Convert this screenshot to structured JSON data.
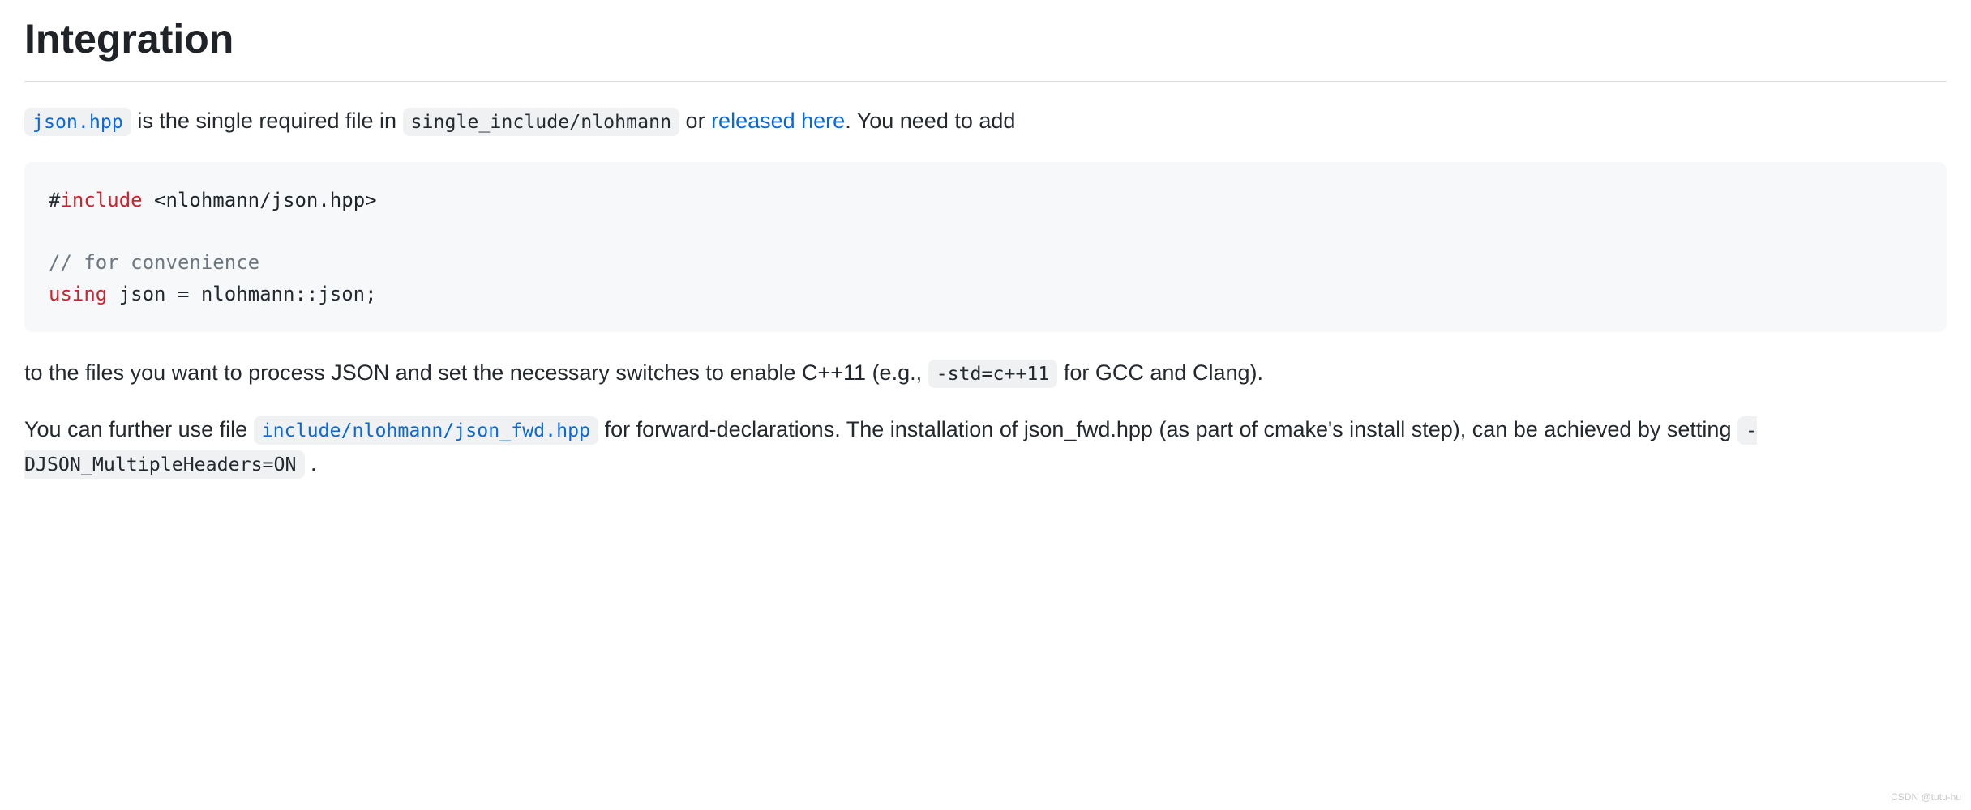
{
  "heading": "Integration",
  "para1": {
    "code_jsonhpp": "json.hpp",
    "text1": " is the single required file in ",
    "code_singleinc": "single_include/nlohmann",
    "text2": " or ",
    "link_released": "released here",
    "text3": ". You need to add"
  },
  "codeblock": {
    "hash": "#",
    "include": "include",
    "header": " <nlohmann/json.hpp>",
    "blank": "",
    "comment": "// for convenience",
    "using": "using",
    "usingRest": " json = nlohmann::json;"
  },
  "para2": {
    "text1": "to the files you want to process JSON and set the necessary switches to enable C++11 (e.g., ",
    "code_std": "-std=c++11",
    "text2": " for GCC and Clang)."
  },
  "para3": {
    "text1": "You can further use file ",
    "code_fwd": "include/nlohmann/json_fwd.hpp",
    "text2": " for forward-declarations. The installation of json_fwd.hpp (as part of cmake's install step), can be achieved by setting ",
    "code_cmake": "-DJSON_MultipleHeaders=ON",
    "text3": " ."
  },
  "watermark": "CSDN @tutu-hu"
}
